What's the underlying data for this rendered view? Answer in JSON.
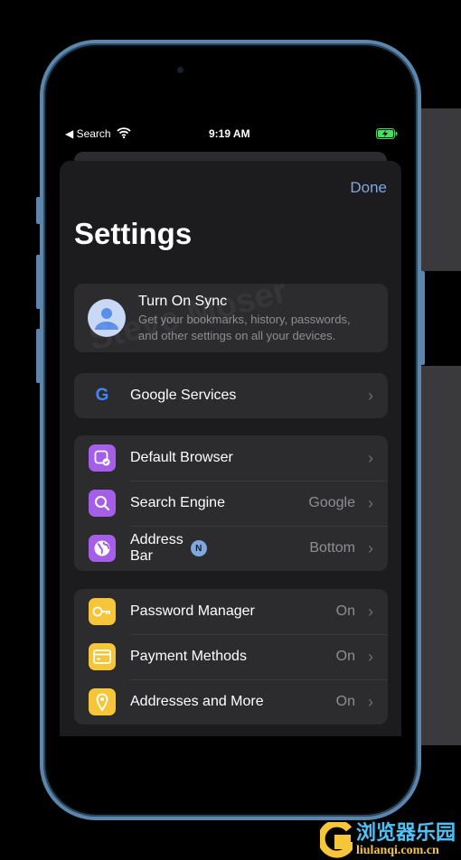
{
  "status_bar": {
    "back": "◀ Search",
    "time": "9:19 AM"
  },
  "header": {
    "done": "Done",
    "title": "Settings"
  },
  "sync": {
    "title": "Turn On Sync",
    "subtitle_line1": "Get your bookmarks, history, passwords,",
    "subtitle_line2": "and other settings on all your devices."
  },
  "google_services": {
    "label": "Google Services",
    "icon": "google-g-icon"
  },
  "group1": [
    {
      "label": "Default Browser",
      "value": "",
      "icon": "default-browser-icon"
    },
    {
      "label": "Search Engine",
      "value": "Google",
      "icon": "search-icon"
    },
    {
      "label": "Address Bar",
      "value": "Bottom",
      "icon": "globe-icon",
      "badge": "N"
    }
  ],
  "group2": [
    {
      "label": "Password Manager",
      "value": "On",
      "icon": "key-icon"
    },
    {
      "label": "Payment Methods",
      "value": "On",
      "icon": "card-icon"
    },
    {
      "label": "Addresses and More",
      "value": "On",
      "icon": "location-pin-icon"
    }
  ],
  "watermarks": {
    "overlay": "Steve Moser",
    "site_name": "浏览器乐园",
    "site_url": "liulanqi.com.cn"
  },
  "colors": {
    "accent": "#7fa8e0",
    "purple": "#a45ee8",
    "yellow": "#f6c53a",
    "frame": "#5d86ad"
  }
}
